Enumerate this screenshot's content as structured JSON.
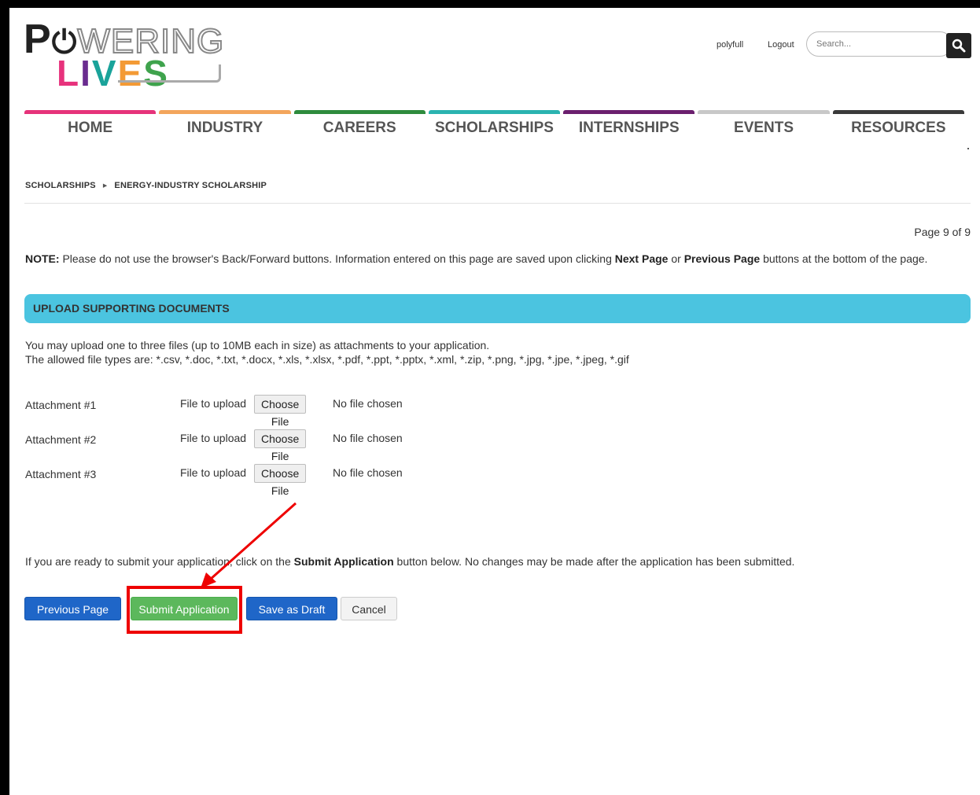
{
  "logo": {
    "line1_lead": "P",
    "line1_rest": "WERING",
    "line2": [
      "L",
      "I",
      "V",
      "E",
      "S"
    ]
  },
  "header": {
    "user_link": "polyfull",
    "logout_link": "Logout",
    "search_placeholder": "Search..."
  },
  "nav": {
    "items": [
      {
        "label": "HOME",
        "color": "#e6337a"
      },
      {
        "label": "INDUSTRY",
        "color": "#f3a55c"
      },
      {
        "label": "CAREERS",
        "color": "#2e8b3d"
      },
      {
        "label": "SCHOLARSHIPS",
        "color": "#2bb3b0"
      },
      {
        "label": "INTERNSHIPS",
        "color": "#6b1f6e"
      },
      {
        "label": "EVENTS",
        "color": "#c8c8c8"
      },
      {
        "label": "RESOURCES",
        "color": "#3a3a3a"
      }
    ]
  },
  "breadcrumb": {
    "items": [
      "SCHOLARSHIPS",
      "ENERGY-INDUSTRY SCHOLARSHIP"
    ]
  },
  "page_indicator": "Page 9 of 9",
  "note": {
    "label": "NOTE:",
    "text_1": " Please do not use the browser's Back/Forward buttons. Information entered on this page are saved upon clicking ",
    "next_page": "Next Page",
    "or": " or ",
    "previous_page": "Previous Page",
    "text_2": " buttons at the bottom of the page."
  },
  "section_title": "UPLOAD SUPPORTING DOCUMENTS",
  "instructions": {
    "line1": "You may upload one to three files (up to 10MB each in size) as attachments to your application.",
    "line2": "The allowed file types are: *.csv, *.doc, *.txt, *.docx, *.xls, *.xlsx, *.pdf, *.ppt, *.pptx, *.xml, *.zip, *.png, *.jpg, *.jpe, *.jpeg, *.gif"
  },
  "attachments": [
    {
      "label": "Attachment #1",
      "file_to_upload": "File to upload",
      "choose_file": "Choose File",
      "status": "No file chosen"
    },
    {
      "label": "Attachment #2",
      "file_to_upload": "File to upload",
      "choose_file": "Choose File",
      "status": "No file chosen"
    },
    {
      "label": "Attachment #3",
      "file_to_upload": "File to upload",
      "choose_file": "Choose File",
      "status": "No file chosen"
    }
  ],
  "submit_note": {
    "text_1": "If you are ready to submit your application, click on the ",
    "bold": "Submit Application",
    "text_2": " button below. No changes may be made after the application has been submitted."
  },
  "buttons": {
    "previous": "Previous Page",
    "submit": "Submit Application",
    "draft": "Save as Draft",
    "cancel": "Cancel"
  },
  "annotation": {
    "highlight_color": "#ee0000"
  }
}
